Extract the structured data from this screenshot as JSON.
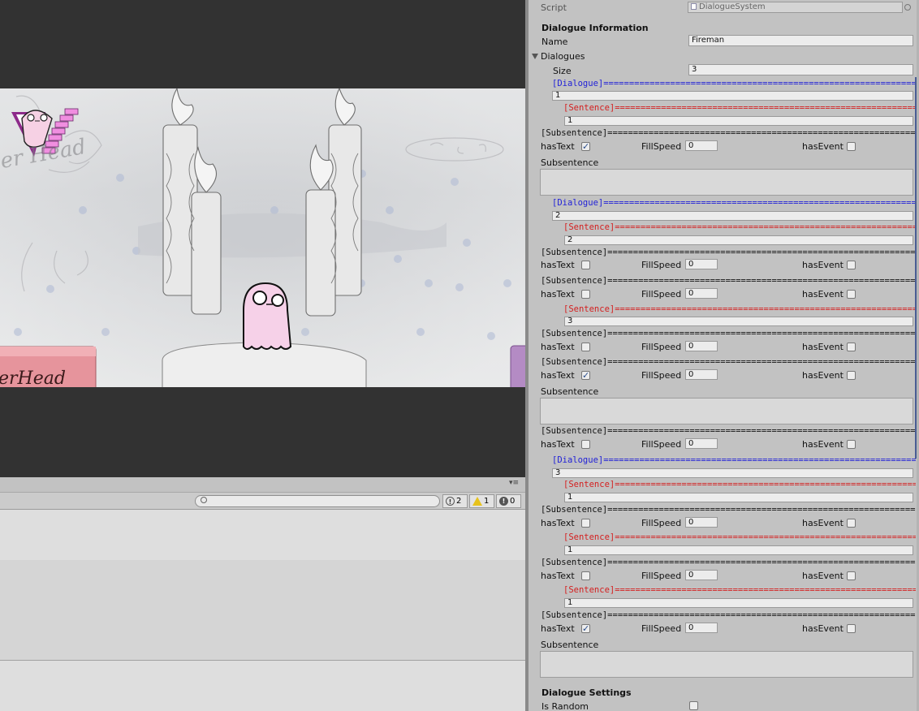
{
  "console": {
    "menu_glyph": "▾≡",
    "search": {
      "placeholder": ""
    },
    "counts": {
      "info": "2",
      "warnings": "1",
      "errors": "0"
    }
  },
  "scene": {
    "sign_text": "erHead",
    "sign_text_top": "er Head"
  },
  "inspector": {
    "script_label": "Script",
    "script_value": "DialogueSystem",
    "info_header": "Dialogue Information",
    "name_label": "Name",
    "name_value": "Fireman",
    "dialogues_label": "Dialogues",
    "size_label": "Size",
    "size_value": "3",
    "dialogue_sep": "[Dialogue]===================================================================",
    "sentence_sep": "[Sentence]===================================================================",
    "subsentence_sep": "[Subsentence]=================================================================",
    "hastext_label": "hasText",
    "fillspeed_label": "FillSpeed",
    "hasevent_label": "hasEvent",
    "subsentence_label": "Subsentence",
    "values": {
      "d1": "1",
      "d1s1": "1",
      "d1s1ss1_fill": "0",
      "d2": "2",
      "d2s1": "2",
      "d2s1ss1_fill": "0",
      "d2s1ss2_fill": "0",
      "d2s2": "3",
      "d2s2ss1_fill": "0",
      "d2s2ss2_fill": "0",
      "d2s2ss3_fill": "0",
      "d3": "3",
      "d3s1": "1",
      "d3s1ss1_fill": "0",
      "d3s2": "1",
      "d3s2ss1_fill": "0",
      "d3s3": "1",
      "d3s3ss1_fill": "0"
    },
    "settings_header": "Dialogue Settings",
    "is_random_label": "Is Random"
  }
}
